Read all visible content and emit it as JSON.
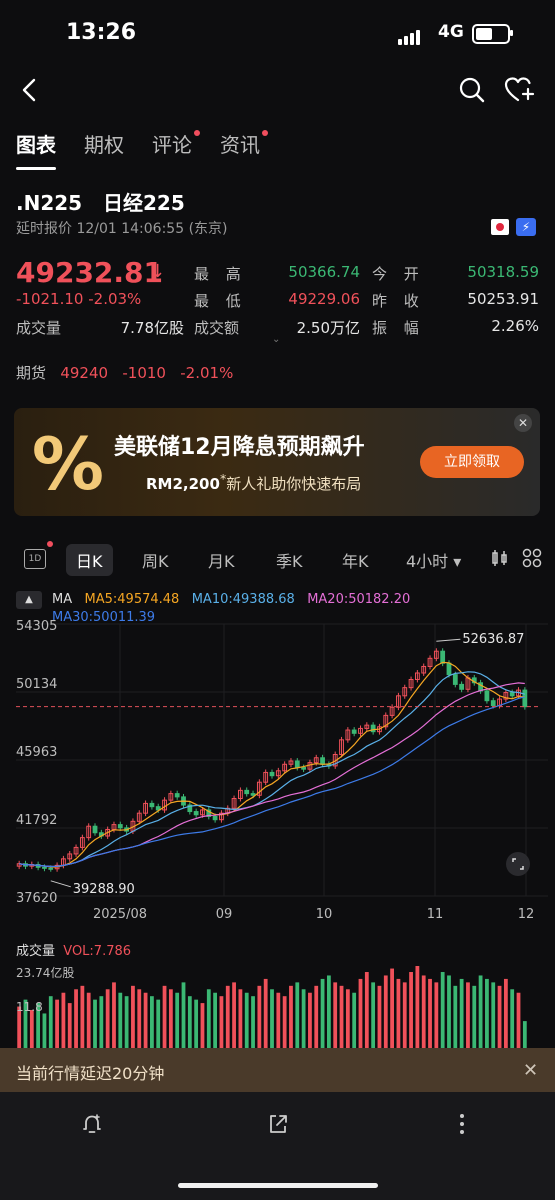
{
  "status_bar": {
    "time": "13:26",
    "network": "4G"
  },
  "tabs": [
    {
      "label": "图表",
      "active": true,
      "badge": false
    },
    {
      "label": "期权",
      "active": false,
      "badge": false
    },
    {
      "label": "评论",
      "active": false,
      "badge": true
    },
    {
      "label": "资讯",
      "active": false,
      "badge": true
    }
  ],
  "header": {
    "symbol": ".N225",
    "name": "日经225",
    "quote_time": "延时报价 12/01 14:06:55 (东京)"
  },
  "quote": {
    "price": "49232.81",
    "change": "-1021.10",
    "change_pct": "-2.03%",
    "volume_label": "成交量",
    "volume": "7.78亿股",
    "high_label": "最 高",
    "high": "50366.74",
    "low_label": "最 低",
    "low": "49229.06",
    "amount_label": "成交额",
    "amount": "2.50万亿",
    "open_label": "今 开",
    "open": "50318.59",
    "prev_close_label": "昨 收",
    "prev_close": "50253.91",
    "amplitude_label": "振 幅",
    "amplitude": "2.26%"
  },
  "futures": {
    "label": "期货",
    "price": "49240",
    "change": "-1010",
    "change_pct": "-2.01%"
  },
  "banner": {
    "title": "美联储12月降息预期飙升",
    "sub_amount": "RM2,200",
    "sub_star": "*",
    "sub_text": "新人礼助你快速布局",
    "button": "立即领取",
    "glyph": "%"
  },
  "periods": [
    "日K",
    "周K",
    "月K",
    "季K",
    "年K",
    "4小时"
  ],
  "period_icon": "1D",
  "ma": {
    "label": "MA",
    "ma5": "MA5:49574.48",
    "ma10": "MA10:49388.68",
    "ma20": "MA20:50182.20",
    "ma30": "MA30:50011.39",
    "colors": {
      "ma5": "#f5a623",
      "ma10": "#5ab0e8",
      "ma20": "#e46fd6",
      "ma30": "#3d7be8"
    }
  },
  "chart_data": {
    "type": "candlestick",
    "y_ticks": [
      "54305",
      "50134",
      "45963",
      "41792",
      "37620"
    ],
    "ylim": [
      37620,
      54305
    ],
    "x_ticks": [
      "2025/08",
      "09",
      "10",
      "11",
      "12"
    ],
    "annotations": {
      "max": "52636.87",
      "min": "39288.90"
    },
    "current_price": 49232.81,
    "closes": [
      39600,
      39450,
      39550,
      39380,
      39320,
      39288.9,
      39500,
      39900,
      40200,
      40600,
      41200,
      41900,
      41500,
      41300,
      41700,
      42000,
      41800,
      41600,
      42200,
      42700,
      43300,
      43100,
      42900,
      43500,
      43900,
      43700,
      43200,
      42800,
      42600,
      42900,
      42500,
      42300,
      42700,
      43000,
      43600,
      44100,
      43900,
      43800,
      44600,
      45200,
      45000,
      45300,
      45700,
      45900,
      45500,
      45400,
      45800,
      46100,
      45700,
      45600,
      46300,
      47200,
      47800,
      47600,
      47900,
      48100,
      47700,
      48000,
      48700,
      49200,
      49900,
      50400,
      50900,
      51300,
      51700,
      52200,
      52636.87,
      51900,
      51200,
      50600,
      50300,
      51000,
      50700,
      50200,
      49600,
      49300,
      49700,
      50100,
      49900,
      50250,
      49232.81
    ],
    "colors": {
      "up": "#f0515a",
      "down": "#3bb874"
    }
  },
  "volume": {
    "label": "成交量",
    "value": "VOL:7.786",
    "max_label": "23.74亿股",
    "mid_label": "11.8",
    "values": [
      12,
      14,
      11,
      13,
      10,
      15,
      14,
      16,
      13,
      17,
      18,
      16,
      14,
      15,
      17,
      19,
      16,
      15,
      18,
      17,
      16,
      15,
      14,
      18,
      17,
      16,
      19,
      15,
      14,
      13,
      17,
      16,
      15,
      18,
      19,
      17,
      16,
      15,
      18,
      20,
      17,
      16,
      15,
      18,
      19,
      17,
      16,
      18,
      20,
      21,
      19,
      18,
      17,
      16,
      20,
      22,
      19,
      18,
      21,
      23,
      20,
      19,
      22,
      23.74,
      21,
      20,
      19,
      22,
      21,
      18,
      20,
      19,
      18,
      21,
      20,
      19,
      18,
      20,
      17,
      16,
      7.786
    ]
  },
  "notice": {
    "text": "当前行情延迟20分钟"
  }
}
